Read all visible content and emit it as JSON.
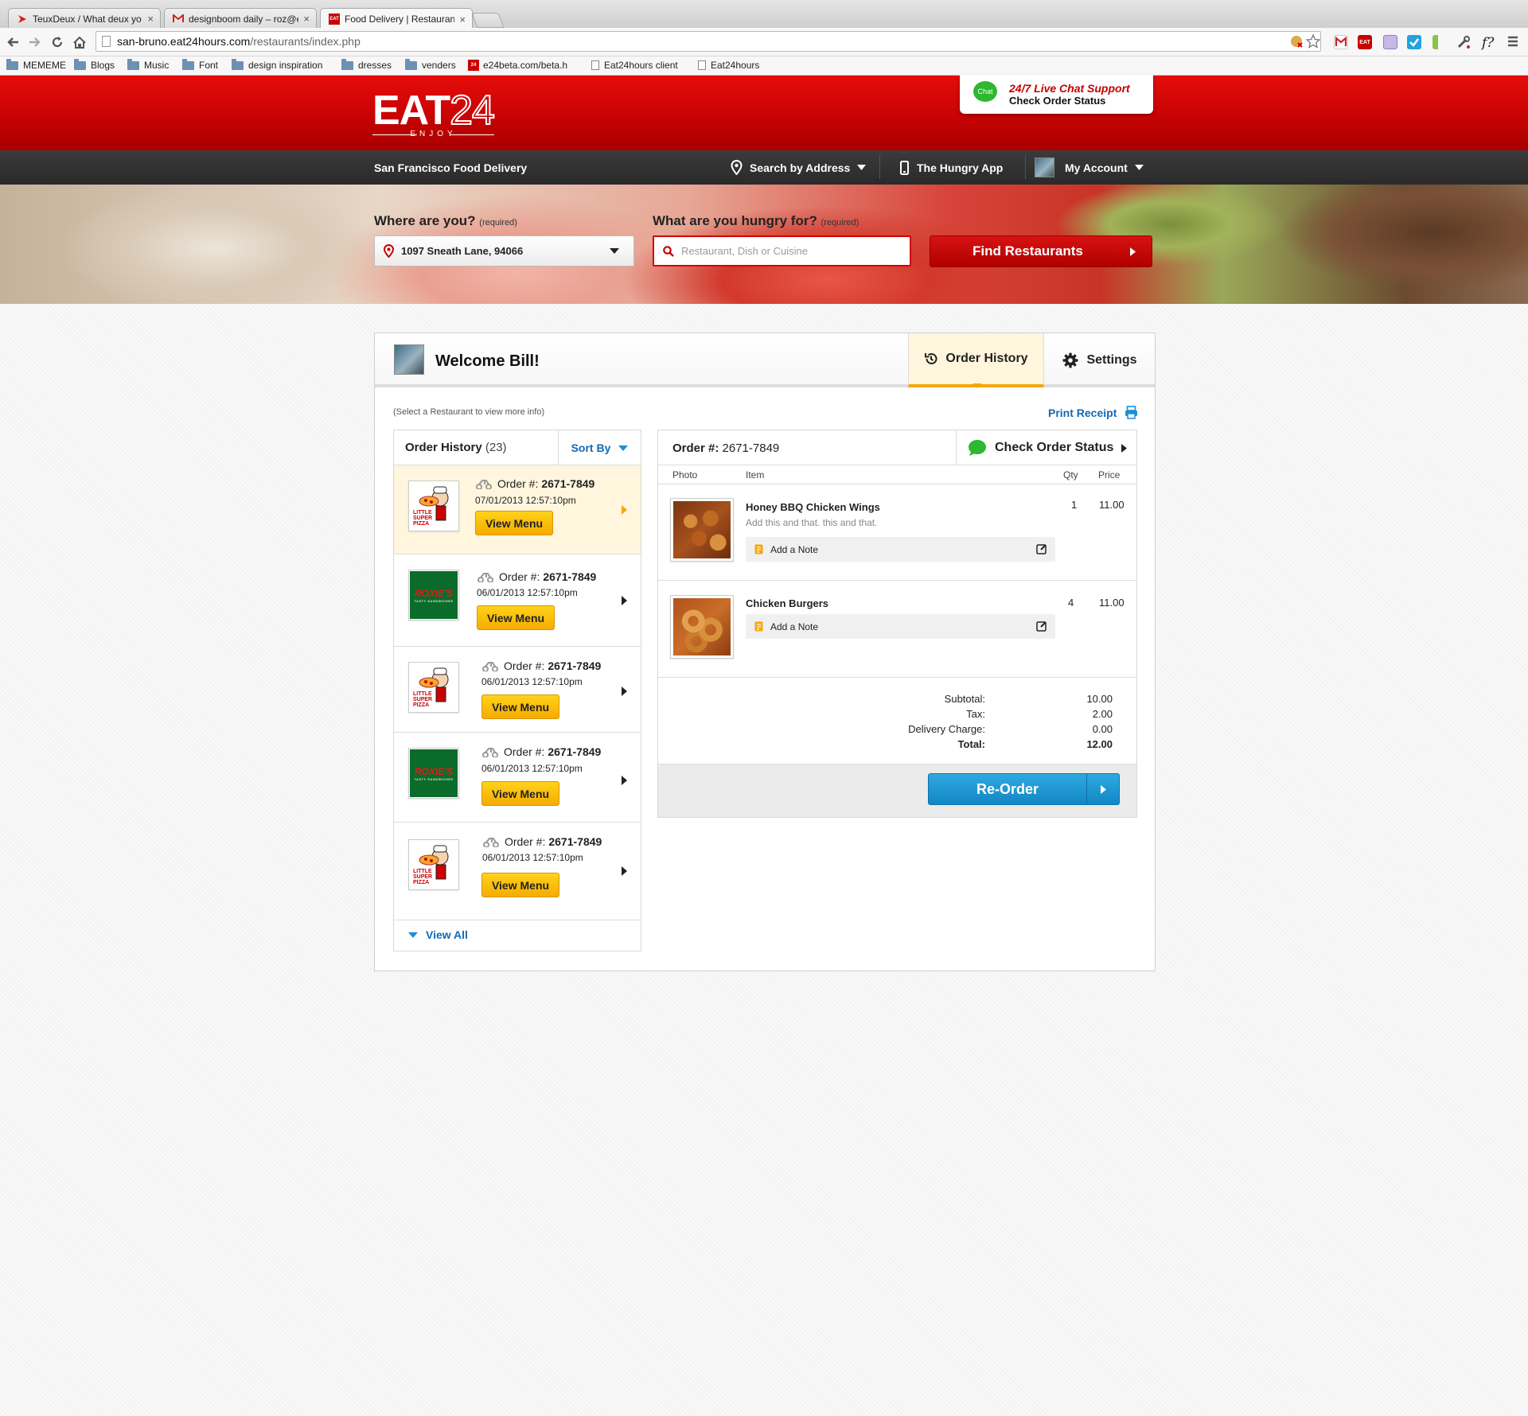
{
  "browser": {
    "tabs": [
      {
        "title": "TeuxDeux / What deux yo",
        "favicon": "teuxdeux-icon"
      },
      {
        "title": "designboom daily – roz@e",
        "favicon": "gmail-icon"
      },
      {
        "title": "Food Delivery | Restaurant",
        "favicon": "eat24-icon"
      }
    ],
    "url_host": "san-bruno.eat24hours.com",
    "url_path": "/restaurants/index.php",
    "bookmarks": [
      {
        "label": "MEMEME",
        "type": "folder"
      },
      {
        "label": "Blogs",
        "type": "folder"
      },
      {
        "label": "Music",
        "type": "folder"
      },
      {
        "label": "Font",
        "type": "folder"
      },
      {
        "label": "design inspiration",
        "type": "folder"
      },
      {
        "label": "dresses",
        "type": "folder"
      },
      {
        "label": "venders",
        "type": "folder"
      },
      {
        "label": "e24beta.com/beta.h",
        "type": "eat24"
      },
      {
        "label": "Eat24hours client",
        "type": "page"
      },
      {
        "label": "Eat24hours",
        "type": "page"
      }
    ]
  },
  "header": {
    "logo_main": "EAT",
    "logo_num": "24",
    "logo_sub": "ENJOY",
    "chat_icon_label": "Chat",
    "chat_line1": "24/7 Live Chat Support",
    "chat_line2": "Check Order Status",
    "brand_color": "#c80000"
  },
  "nav": {
    "city": "San Francisco Food Delivery",
    "search_by_address": "Search by Address",
    "hungry_app": "The Hungry App",
    "my_account": "My Account"
  },
  "search": {
    "where_label": "Where are you?",
    "where_req": "(required)",
    "address": "1097 Sneath Lane, 94066",
    "what_label": "What are you hungry for?",
    "what_req": "(required)",
    "placeholder": "Restaurant, Dish or Cuisine",
    "find_button": "Find Restaurants"
  },
  "panel": {
    "welcome": "Welcome Bill!",
    "tab_order_history": "Order History",
    "tab_settings": "Settings",
    "hint": "(Select a Restaurant to view more info)",
    "print_receipt": "Print Receipt"
  },
  "history": {
    "title": "Order History",
    "count": "(23)",
    "sort_by": "Sort By",
    "view_all": "View All",
    "orders": [
      {
        "restaurant": "Little Super Pizza",
        "logo_text": "LITTLE SUPER PIZZA",
        "order_label": "Order #:",
        "order_no": "2671-7849",
        "date": "07/01/2013 12:57:10pm",
        "button": "View Menu",
        "selected": true
      },
      {
        "restaurant": "Roxie's",
        "logo_text": "ROXIE'S",
        "logo_sub": "TASTY SANDWICHES",
        "order_label": "Order #:",
        "order_no": "2671-7849",
        "date": "06/01/2013 12:57:10pm",
        "button": "View Menu",
        "selected": false
      },
      {
        "restaurant": "Little Super Pizza",
        "logo_text": "LITTLE SUPER PIZZA",
        "order_label": "Order #:",
        "order_no": "2671-7849",
        "date": "06/01/2013 12:57:10pm",
        "button": "View Menu",
        "selected": false
      },
      {
        "restaurant": "Roxie's",
        "logo_text": "ROXIE'S",
        "logo_sub": "TASTY SANDWICHES",
        "order_label": "Order #:",
        "order_no": "2671-7849",
        "date": "06/01/2013 12:57:10pm",
        "button": "View Menu",
        "selected": false
      },
      {
        "restaurant": "Little Super Pizza",
        "logo_text": "LITTLE SUPER PIZZA",
        "order_label": "Order #:",
        "order_no": "2671-7849",
        "date": "06/01/2013 12:57:10pm",
        "button": "View Menu",
        "selected": false
      }
    ]
  },
  "order": {
    "label": "Order #:",
    "number": "2671-7849",
    "check_status": "Check Order Status",
    "col_photo": "Photo",
    "col_item": "Item",
    "col_qty": "Qty",
    "col_price": "Price",
    "items": [
      {
        "name": "Honey BBQ Chicken Wings",
        "desc": "Add this and that. this and that.",
        "note": "Add a Note",
        "qty": "1",
        "price": "11.00",
        "photo": "chicken-wings-photo"
      },
      {
        "name": "Chicken Burgers",
        "desc": "",
        "note": "Add a Note",
        "qty": "4",
        "price": "11.00",
        "photo": "onion-rings-photo"
      }
    ],
    "subtotal_label": "Subtotal:",
    "subtotal": "10.00",
    "tax_label": "Tax:",
    "tax": "2.00",
    "delivery_label": "Delivery Charge:",
    "delivery": "0.00",
    "total_label": "Total:",
    "total": "12.00",
    "reorder": "Re-Order"
  }
}
